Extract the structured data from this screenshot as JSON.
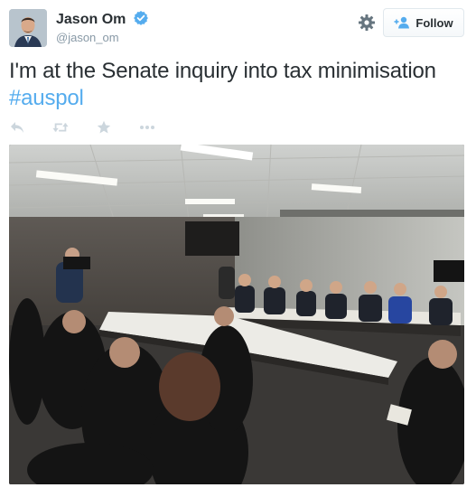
{
  "user": {
    "name": "Jason Om",
    "handle": "@jason_om",
    "verified": true
  },
  "header": {
    "follow_label": "Follow",
    "settings_icon": "gear-icon",
    "follow_icon": "add-user-icon"
  },
  "tweet": {
    "text": "I'm at the Senate inquiry into tax minimisation",
    "hashtag": "#auspol"
  },
  "actions": [
    {
      "icon": "reply-icon"
    },
    {
      "icon": "retweet-icon"
    },
    {
      "icon": "favorite-star-icon"
    },
    {
      "icon": "more-dots-icon"
    }
  ],
  "colors": {
    "link": "#55acee",
    "verified": "#55acee",
    "action_icon": "#ccd6dd",
    "text": "#292f33",
    "secondary": "#8899a6"
  }
}
